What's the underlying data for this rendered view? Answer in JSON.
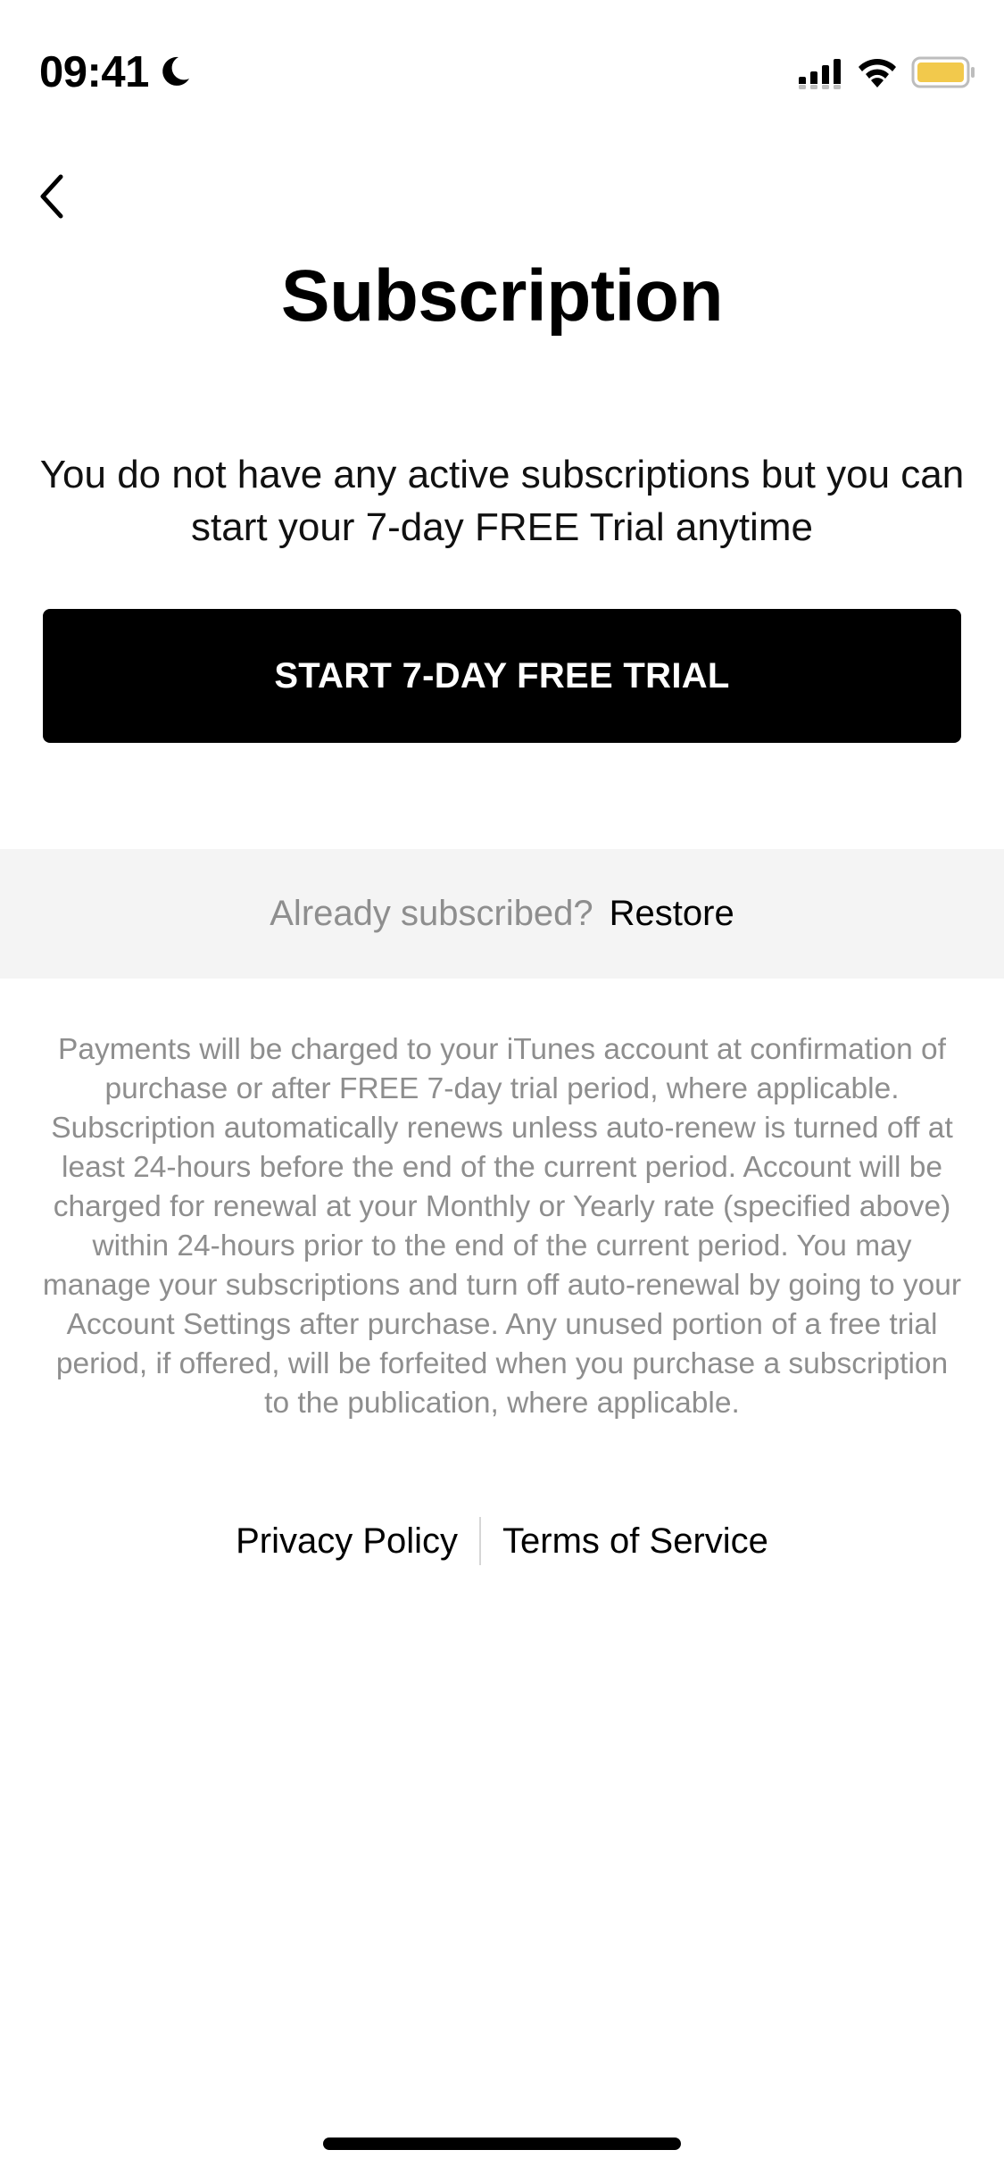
{
  "status_bar": {
    "time": "09:41",
    "icons": [
      "moon-icon",
      "cellular-signal-icon",
      "wifi-icon",
      "battery-icon"
    ],
    "battery_color": "#f2c94c"
  },
  "nav": {
    "back_icon": "chevron-left-icon"
  },
  "page": {
    "title": "Subscription",
    "message": "You do not have any active subscriptions but you can start your 7-day FREE Trial anytime"
  },
  "cta": {
    "trial_label": "START 7-DAY FREE TRIAL",
    "background_color": "#000000",
    "text_color": "#ffffff"
  },
  "restore": {
    "prompt": "Already subscribed?",
    "link_label": "Restore",
    "band_color": "#f4f4f4"
  },
  "legal": {
    "text": "Payments will be charged to your iTunes account at confirmation of purchase or after FREE 7-day trial period, where applicable. Subscription automatically renews unless auto-renew is turned off at least 24-hours before the end of the current period. Account will be charged for renewal at your Monthly or Yearly rate (specified above) within 24-hours prior to the end of the current period. You may manage your subscriptions and turn off auto-renewal by going to your Account Settings after purchase. Any unused portion of a free trial period, if offered, will be forfeited when you purchase a subscription to the publication, where applicable."
  },
  "footer": {
    "privacy_label": "Privacy Policy",
    "terms_label": "Terms of Service"
  }
}
